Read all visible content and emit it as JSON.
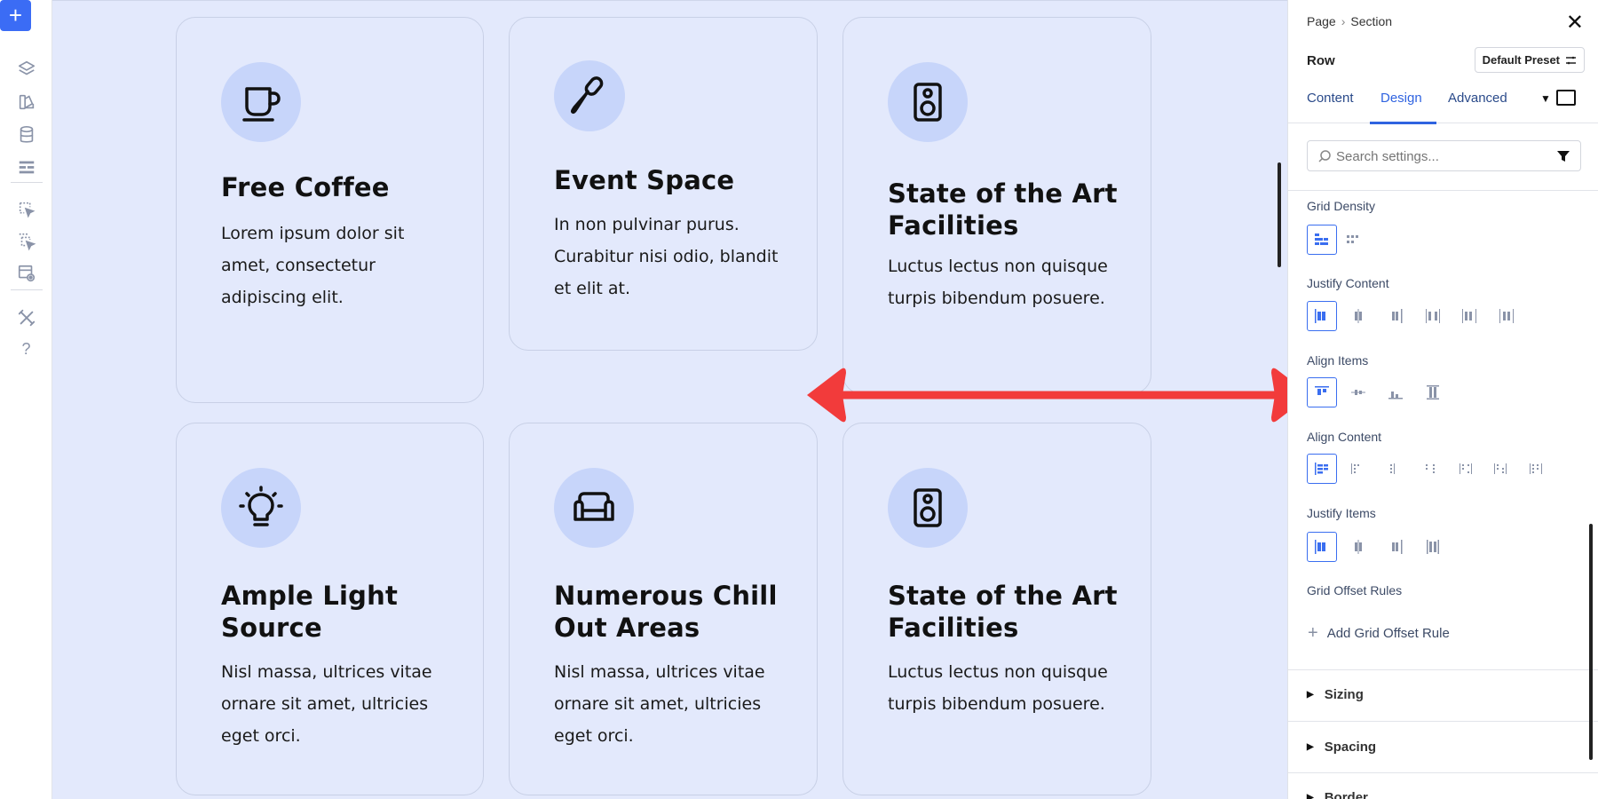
{
  "toolbar": {
    "items": [
      "add",
      "layers",
      "color-styles",
      "database",
      "page-structure",
      "select-element",
      "multi-select",
      "preview",
      "tools",
      "help"
    ],
    "help_label": "?"
  },
  "canvas": {
    "cards": [
      {
        "title": "Free Coffee",
        "text": "Lorem ipsum dolor sit amet, consectetur adipiscing elit.",
        "icon": "coffee-cup-icon"
      },
      {
        "title": "Event Space",
        "text": "In non pulvinar purus. Curabitur nisi odio, blandit et elit at.",
        "icon": "microphone-icon"
      },
      {
        "title": "State of the Art Facilities",
        "text": "Luctus lectus non quisque turpis bibendum posuere.",
        "icon": "speaker-icon"
      },
      {
        "title": "Ample Light Source",
        "text": "Nisl massa, ultrices vitae ornare sit amet, ultricies eget orci.",
        "icon": "light-bulb-icon"
      },
      {
        "title": "Numerous Chill Out Areas",
        "text": "Nisl massa, ultrices vitae ornare sit amet, ultricies eget orci.",
        "icon": "sofa-icon"
      },
      {
        "title": "State of the Art Facilities",
        "text": "Luctus lectus non quisque turpis bibendum posuere.",
        "icon": "speaker-icon"
      }
    ],
    "colors": {
      "background": "#e3e9fc",
      "icon_circle": "#c7d5fa",
      "arrow": "#f23b3b"
    }
  },
  "panel": {
    "breadcrumb": [
      "Page",
      "Section"
    ],
    "breadcrumb_sep": "›",
    "close_label": "✕",
    "module_title": "Row",
    "preset_label": "Default Preset",
    "tabs": [
      "Content",
      "Design",
      "Advanced"
    ],
    "active_tab": "Design",
    "tab_dropdown": "▼",
    "search_placeholder": "Search settings...",
    "groups": {
      "grid_density": "Grid Density",
      "justify_content": "Justify Content",
      "align_items": "Align Items",
      "align_content": "Align Content",
      "justify_items": "Justify Items",
      "grid_offset_rules": "Grid Offset Rules"
    },
    "add_rule_label": "Add Grid Offset Rule",
    "add_rule_plus": "+",
    "sections": [
      "Sizing",
      "Spacing",
      "Border"
    ],
    "accent": "#2f63e0"
  }
}
